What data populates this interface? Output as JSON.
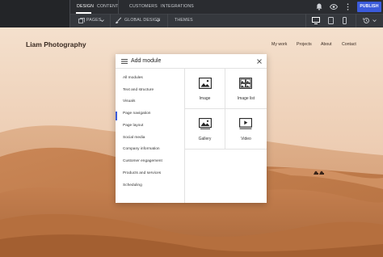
{
  "topnav": {
    "tabs": [
      {
        "label": "DESIGN",
        "active": true
      },
      {
        "label": "CONTENT",
        "active": false
      },
      {
        "label": "CUSTOMERS",
        "active": false
      },
      {
        "label": "INTEGRATIONS",
        "active": false
      }
    ],
    "publish_label": "PUBLISH"
  },
  "toolbar": {
    "pages_label": "PAGES",
    "global_design_label": "GLOBAL DESIGN",
    "themes_label": "THEMES"
  },
  "site": {
    "title": "Liam Photography",
    "nav": [
      "My work",
      "Projects",
      "About",
      "Contact"
    ]
  },
  "modal": {
    "title": "Add module",
    "categories": [
      "All modules",
      "Text and structure",
      "Visuals",
      "Page navigation",
      "Page layout",
      "Social media",
      "Company information",
      "Customer engagement",
      "Products and services",
      "Scheduling"
    ],
    "selected_category": "Visuals",
    "tiles": [
      {
        "label": "Image",
        "icon": "image-icon"
      },
      {
        "label": "Image list",
        "icon": "image-list-icon"
      },
      {
        "label": "Gallery",
        "icon": "gallery-icon"
      },
      {
        "label": "Video",
        "icon": "video-icon"
      }
    ]
  },
  "colors": {
    "accent": "#3b5bdb",
    "topbar": "#2a2c30",
    "toolbar": "#35383d",
    "desert_sky": "#f2dbc6",
    "desert_sand": "#c77e4f"
  }
}
